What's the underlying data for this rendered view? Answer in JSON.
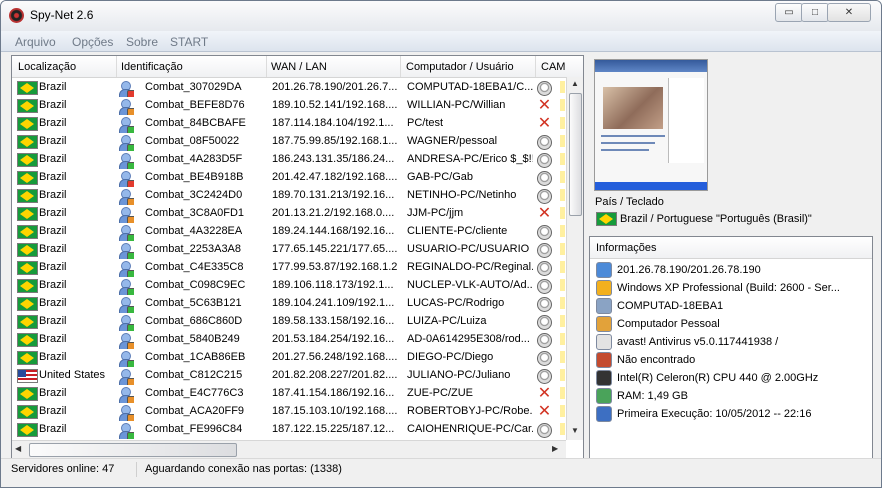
{
  "window": {
    "title": "Spy-Net 2.6",
    "controls": {
      "minimize": "▭",
      "maximize": "□",
      "close": "✕"
    }
  },
  "menu": [
    "Arquivo",
    "Opções",
    "Sobre",
    "START"
  ],
  "grid": {
    "columns": [
      "Localização",
      "Identificação",
      "WAN / LAN",
      "Computador / Usuário",
      "CAM"
    ],
    "rows": [
      {
        "country": "Brazil",
        "flag": "br",
        "id": "Combat_307029DA",
        "wan": "201.26.78.190/201.26.7...",
        "comp": "COMPUTAD-18EBA1/C...",
        "cam": "webcam",
        "status": "#e23a2e"
      },
      {
        "country": "Brazil",
        "flag": "br",
        "id": "Combat_BEFE8D76",
        "wan": "189.10.52.141/192.168....",
        "comp": "WILLIAN-PC/Willian",
        "cam": "none",
        "status": "#e8902a"
      },
      {
        "country": "Brazil",
        "flag": "br",
        "id": "Combat_84BCBAFE",
        "wan": "187.114.184.104/192.1...",
        "comp": "PC/test",
        "cam": "none",
        "status": "#38b83f"
      },
      {
        "country": "Brazil",
        "flag": "br",
        "id": "Combat_08F50022",
        "wan": "187.75.99.85/192.168.1...",
        "comp": "WAGNER/pessoal",
        "cam": "webcam",
        "status": "#38b83f"
      },
      {
        "country": "Brazil",
        "flag": "br",
        "id": "Combat_4A283D5F",
        "wan": "186.243.131.35/186.24...",
        "comp": "ANDRESA-PC/Erico $_$!!!",
        "cam": "webcam",
        "status": "#38b83f"
      },
      {
        "country": "Brazil",
        "flag": "br",
        "id": "Combat_BE4B918B",
        "wan": "201.42.47.182/192.168....",
        "comp": "GAB-PC/Gab",
        "cam": "webcam",
        "status": "#e23a2e"
      },
      {
        "country": "Brazil",
        "flag": "br",
        "id": "Combat_3C2424D0",
        "wan": "189.70.131.213/192.16...",
        "comp": "NETINHO-PC/Netinho",
        "cam": "webcam",
        "status": "#e8902a"
      },
      {
        "country": "Brazil",
        "flag": "br",
        "id": "Combat_3C8A0FD1",
        "wan": "201.13.21.2/192.168.0....",
        "comp": "JJM-PC/jjm",
        "cam": "none",
        "status": "#e8902a"
      },
      {
        "country": "Brazil",
        "flag": "br",
        "id": "Combat_4A3228EA",
        "wan": "189.24.144.168/192.16...",
        "comp": "CLIENTE-PC/cliente",
        "cam": "webcam",
        "status": "#38b83f"
      },
      {
        "country": "Brazil",
        "flag": "br",
        "id": "Combat_2253A3A8",
        "wan": "177.65.145.221/177.65....",
        "comp": "USUARIO-PC/USUARIO",
        "cam": "webcam",
        "status": "#38b83f"
      },
      {
        "country": "Brazil",
        "flag": "br",
        "id": "Combat_C4E335C8",
        "wan": "177.99.53.87/192.168.1.2",
        "comp": "REGINALDO-PC/Reginal...",
        "cam": "webcam",
        "status": "#38b83f"
      },
      {
        "country": "Brazil",
        "flag": "br",
        "id": "Combat_C098C9EC",
        "wan": "189.106.118.173/192.1...",
        "comp": "NUCLEP-VLK-AUTO/Ad...",
        "cam": "webcam",
        "status": "#38b83f"
      },
      {
        "country": "Brazil",
        "flag": "br",
        "id": "Combat_5C63B121",
        "wan": "189.104.241.109/192.1...",
        "comp": "LUCAS-PC/Rodrigo",
        "cam": "webcam",
        "status": "#38b83f"
      },
      {
        "country": "Brazil",
        "flag": "br",
        "id": "Combat_686C860D",
        "wan": "189.58.133.158/192.16...",
        "comp": "LUIZA-PC/Luiza",
        "cam": "webcam",
        "status": "#38b83f"
      },
      {
        "country": "Brazil",
        "flag": "br",
        "id": "Combat_5840B249",
        "wan": "201.53.184.254/192.16...",
        "comp": "AD-0A614295E308/rod...",
        "cam": "webcam",
        "status": "#e8902a"
      },
      {
        "country": "Brazil",
        "flag": "br",
        "id": "Combat_1CAB86EB",
        "wan": "201.27.56.248/192.168....",
        "comp": "DIEGO-PC/Diego",
        "cam": "webcam",
        "status": "#38b83f"
      },
      {
        "country": "United States",
        "flag": "us",
        "id": "Combat_C812C215",
        "wan": "201.82.208.227/201.82....",
        "comp": "JULIANO-PC/Juliano",
        "cam": "webcam",
        "status": "#e8902a"
      },
      {
        "country": "Brazil",
        "flag": "br",
        "id": "Combat_E4C776C3",
        "wan": "187.41.154.186/192.16...",
        "comp": "ZUE-PC/ZUE",
        "cam": "none",
        "status": "#e8902a"
      },
      {
        "country": "Brazil",
        "flag": "br",
        "id": "Combat_ACA20FF9",
        "wan": "187.15.103.10/192.168....",
        "comp": "ROBERTOBYJ-PC/Robe...",
        "cam": "none",
        "status": "#e8902a"
      },
      {
        "country": "Brazil",
        "flag": "br",
        "id": "Combat_FE996C84",
        "wan": "187.122.15.225/187.12...",
        "comp": "CAIOHENRIQUE-PC/Car...",
        "cam": "webcam",
        "status": "#38b83f"
      }
    ]
  },
  "right": {
    "country_label": "País / Teclado",
    "country_value": "Brazil / Portuguese \"Português (Brasil)\"",
    "info_header": "Informações",
    "info": [
      {
        "icon": "network-icon",
        "text": "201.26.78.190/201.26.78.190"
      },
      {
        "icon": "windows-icon",
        "text": "Windows XP Professional (Build: 2600 - Ser..."
      },
      {
        "icon": "computer-icon",
        "text": "COMPUTAD-18EBA1"
      },
      {
        "icon": "user-icon",
        "text": "Computador Pessoal"
      },
      {
        "icon": "antivirus-icon",
        "text": "avast! Antivirus v5.0.117441938 /"
      },
      {
        "icon": "firewall-icon",
        "text": "Não encontrado"
      },
      {
        "icon": "cpu-icon",
        "text": "Intel(R) Celeron(R) CPU 440 @ 2.00GHz"
      },
      {
        "icon": "ram-icon",
        "text": "RAM: 1,49 GB"
      },
      {
        "icon": "clock-icon",
        "text": "Primeira Execução: 10/05/2012 -- 22:16"
      }
    ]
  },
  "statusbar": {
    "servers": "Servidores online: 47",
    "ports": "Aguardando conexão nas portas: (1338)"
  }
}
